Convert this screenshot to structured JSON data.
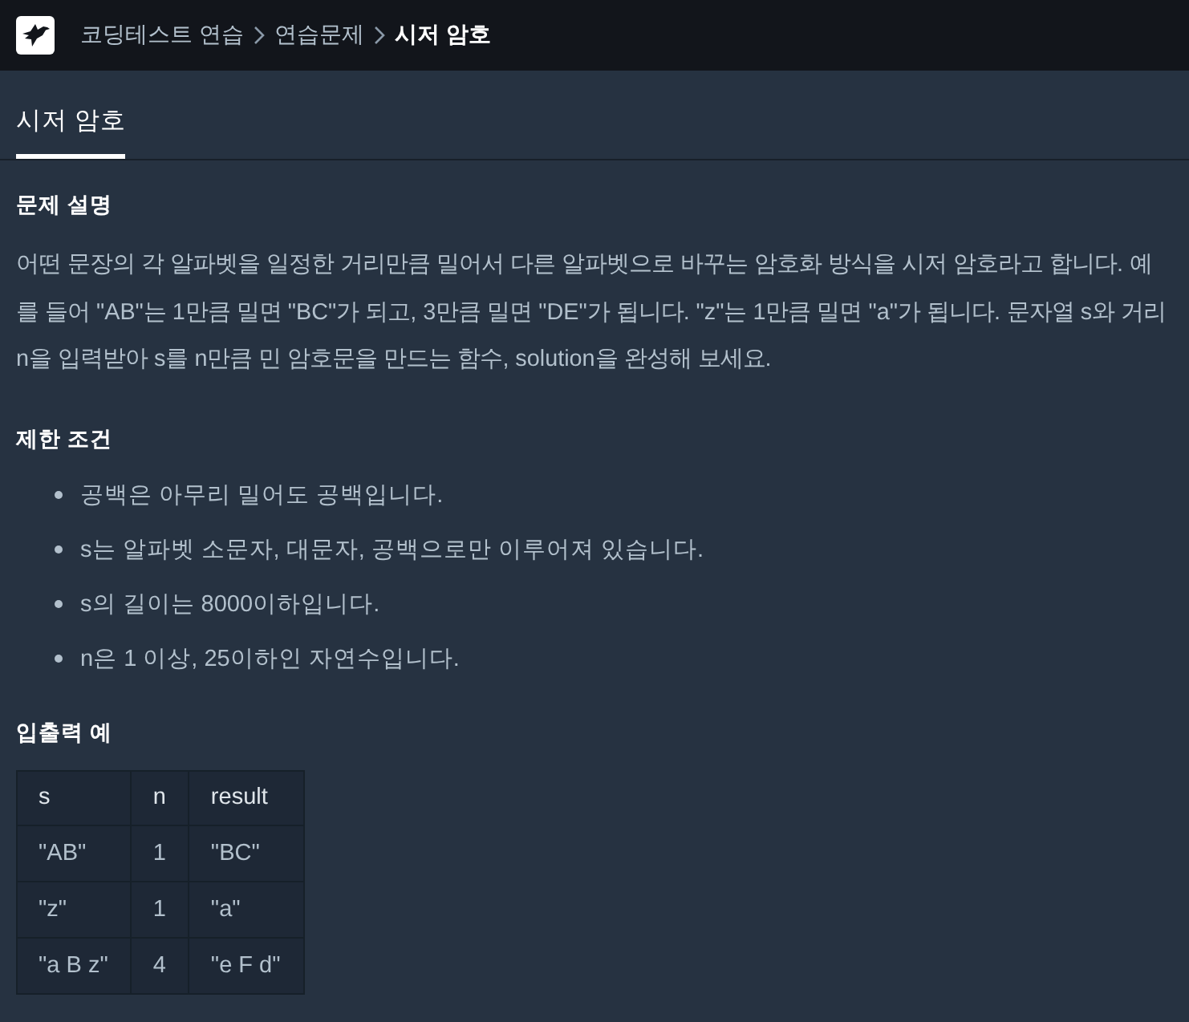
{
  "nav": {
    "breadcrumb": [
      {
        "label": "코딩테스트 연습",
        "current": false
      },
      {
        "label": "연습문제",
        "current": false
      },
      {
        "label": "시저 암호",
        "current": true
      }
    ]
  },
  "tabs": [
    {
      "label": "시저 암호",
      "selected": true
    }
  ],
  "sections": [
    {
      "kind": "text",
      "title": "문제 설명",
      "paragraphs": [
        "어떤 문장의 각 알파벳을 일정한 거리만큼 밀어서 다른 알파벳으로 바꾸는 암호화 방식을 시저 암호라고 합니다. 예를 들어 \"AB\"는 1만큼 밀면 \"BC\"가 되고, 3만큼 밀면 \"DE\"가 됩니다. \"z\"는 1만큼 밀면 \"a\"가 됩니다. 문자열 s와 거리 n을 입력받아 s를 n만큼 민 암호문을 만드는 함수, solution을 완성해 보세요."
      ]
    },
    {
      "kind": "list",
      "title": "제한 조건",
      "items": [
        "공백은 아무리 밀어도 공백입니다.",
        "s는 알파벳 소문자, 대문자, 공백으로만 이루어져 있습니다.",
        "s의 길이는 8000이하입니다.",
        "n은 1 이상, 25이하인 자연수입니다."
      ]
    },
    {
      "kind": "table",
      "title": "입출력 예",
      "table": {
        "columns": [
          "s",
          "n",
          "result"
        ],
        "rows": [
          [
            "\"AB\"",
            "1",
            "\"BC\""
          ],
          [
            "\"z\"",
            "1",
            "\"a\""
          ],
          [
            "\"a B z\"",
            "4",
            "\"e F d\""
          ]
        ]
      }
    }
  ]
}
